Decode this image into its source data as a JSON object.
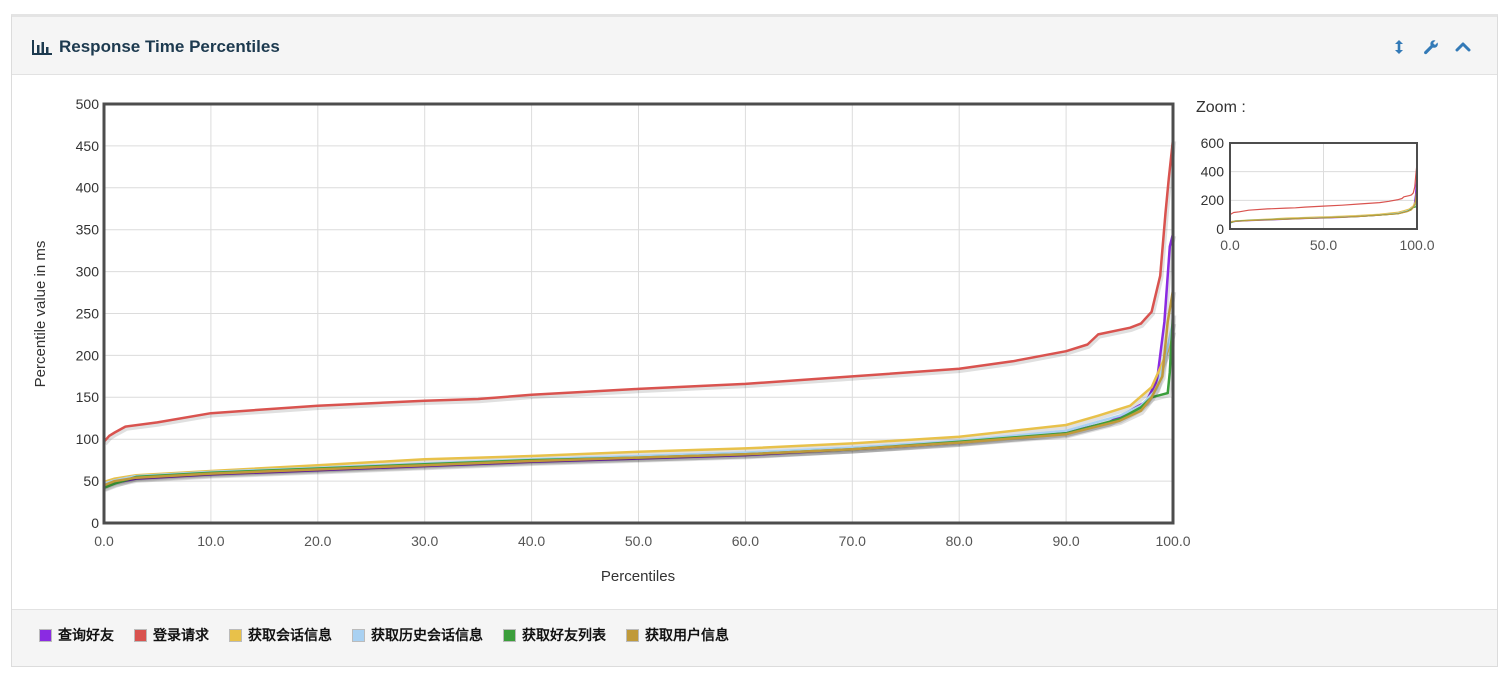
{
  "panel": {
    "title": "Response Time Percentiles",
    "icons": [
      "bar-chart-icon",
      "resize-vertical-icon",
      "wrench-icon",
      "chevron-up-icon"
    ]
  },
  "zoom": {
    "label": "Zoom :"
  },
  "colors": {
    "grid": "#dcdcdc",
    "frame": "#4d4d4d",
    "accent": "#337ab7"
  },
  "chart_data": [
    {
      "type": "line",
      "xlabel": "Percentiles",
      "ylabel": "Percentile value in ms",
      "xlim": [
        0,
        100
      ],
      "ylim": [
        0,
        500
      ],
      "xticks": [
        "0.0",
        "10.0",
        "20.0",
        "30.0",
        "40.0",
        "50.0",
        "60.0",
        "70.0",
        "80.0",
        "90.0",
        "100.0"
      ],
      "yticks": [
        "0",
        "50",
        "100",
        "150",
        "200",
        "250",
        "300",
        "350",
        "400",
        "450",
        "500"
      ],
      "grid": true,
      "legend_position": "bottom",
      "series": [
        {
          "name": "查询好友",
          "color": "#8a2be2",
          "points": [
            [
              0,
              43
            ],
            [
              1,
              48
            ],
            [
              3,
              53
            ],
            [
              10,
              58
            ],
            [
              20,
              63
            ],
            [
              30,
              68
            ],
            [
              40,
              73
            ],
            [
              50,
              77
            ],
            [
              60,
              81
            ],
            [
              70,
              88
            ],
            [
              80,
              96
            ],
            [
              90,
              108
            ],
            [
              94,
              120
            ],
            [
              96,
              134
            ],
            [
              97.5,
              145
            ],
            [
              98.5,
              170
            ],
            [
              99.2,
              240
            ],
            [
              99.7,
              330
            ],
            [
              100,
              345
            ]
          ]
        },
        {
          "name": "登录请求",
          "color": "#d9534f",
          "points": [
            [
              0,
              97
            ],
            [
              0.5,
              104
            ],
            [
              1,
              108
            ],
            [
              2,
              115
            ],
            [
              5,
              120
            ],
            [
              10,
              131
            ],
            [
              20,
              140
            ],
            [
              30,
              146
            ],
            [
              35,
              148
            ],
            [
              40,
              153
            ],
            [
              50,
              160
            ],
            [
              60,
              166
            ],
            [
              70,
              175
            ],
            [
              80,
              184
            ],
            [
              85,
              193
            ],
            [
              90,
              205
            ],
            [
              92,
              213
            ],
            [
              93,
              225
            ],
            [
              96,
              233
            ],
            [
              97,
              238
            ],
            [
              98,
              252
            ],
            [
              98.8,
              295
            ],
            [
              99.3,
              370
            ],
            [
              99.6,
              410
            ],
            [
              100,
              458
            ]
          ]
        },
        {
          "name": "获取会话信息",
          "color": "#e8c14a",
          "points": [
            [
              0,
              49
            ],
            [
              1,
              53
            ],
            [
              3,
              57
            ],
            [
              10,
              62
            ],
            [
              20,
              69
            ],
            [
              30,
              76
            ],
            [
              40,
              80
            ],
            [
              50,
              85
            ],
            [
              60,
              89
            ],
            [
              70,
              95
            ],
            [
              80,
              103
            ],
            [
              90,
              117
            ],
            [
              93,
              128
            ],
            [
              96,
              140
            ],
            [
              98,
              162
            ],
            [
              99.5,
              205
            ],
            [
              100,
              230
            ]
          ]
        },
        {
          "name": "获取历史会话信息",
          "color": "#a9d1f2",
          "points": [
            [
              0,
              47
            ],
            [
              1,
              51
            ],
            [
              3,
              56
            ],
            [
              10,
              61
            ],
            [
              20,
              66
            ],
            [
              30,
              71
            ],
            [
              40,
              76
            ],
            [
              50,
              80
            ],
            [
              60,
              84
            ],
            [
              70,
              90
            ],
            [
              80,
              98
            ],
            [
              90,
              110
            ],
            [
              95,
              128
            ],
            [
              97,
              140
            ],
            [
              98.5,
              160
            ],
            [
              99.5,
              210
            ],
            [
              100,
              240
            ]
          ]
        },
        {
          "name": "获取好友列表",
          "color": "#3b9e3b",
          "points": [
            [
              0,
              42
            ],
            [
              1,
              47
            ],
            [
              3,
              55
            ],
            [
              10,
              60
            ],
            [
              20,
              65
            ],
            [
              30,
              70
            ],
            [
              40,
              75
            ],
            [
              50,
              78
            ],
            [
              60,
              82
            ],
            [
              70,
              88
            ],
            [
              80,
              97
            ],
            [
              90,
              107
            ],
            [
              95,
              124
            ],
            [
              97,
              138
            ],
            [
              98,
              150
            ],
            [
              99.5,
              155
            ],
            [
              99.7,
              180
            ],
            [
              100,
              250
            ]
          ]
        },
        {
          "name": "获取用户信息",
          "color": "#c09a3a",
          "points": [
            [
              0,
              45
            ],
            [
              1,
              50
            ],
            [
              3,
              54
            ],
            [
              10,
              59
            ],
            [
              20,
              64
            ],
            [
              30,
              69
            ],
            [
              40,
              74
            ],
            [
              50,
              78
            ],
            [
              60,
              82
            ],
            [
              70,
              88
            ],
            [
              80,
              96
            ],
            [
              90,
              106
            ],
            [
              95,
              122
            ],
            [
              97,
              134
            ],
            [
              98,
              150
            ],
            [
              99,
              175
            ],
            [
              99.5,
              240
            ],
            [
              100,
              278
            ]
          ]
        }
      ]
    },
    {
      "type": "line",
      "title": "Zoom :",
      "xlim": [
        0,
        100
      ],
      "ylim": [
        0,
        600
      ],
      "xticks": [
        "0.0",
        "50.0",
        "100.0"
      ],
      "yticks": [
        "0",
        "200",
        "400",
        "600"
      ],
      "grid": true
    }
  ]
}
